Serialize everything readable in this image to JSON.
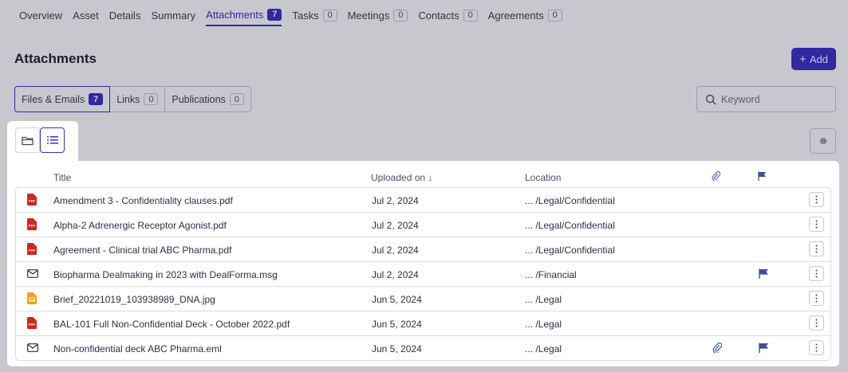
{
  "nav": {
    "tabs": [
      {
        "label": "Overview",
        "count": null
      },
      {
        "label": "Asset",
        "count": null
      },
      {
        "label": "Details",
        "count": null
      },
      {
        "label": "Summary",
        "count": null
      },
      {
        "label": "Attachments",
        "count": "7"
      },
      {
        "label": "Tasks",
        "count": "0"
      },
      {
        "label": "Meetings",
        "count": "0"
      },
      {
        "label": "Contacts",
        "count": "0"
      },
      {
        "label": "Agreements",
        "count": "0"
      }
    ]
  },
  "header": {
    "title": "Attachments",
    "add_label": "Add"
  },
  "subtabs": [
    {
      "label": "Files & Emails",
      "count": "7"
    },
    {
      "label": "Links",
      "count": "0"
    },
    {
      "label": "Publications",
      "count": "0"
    }
  ],
  "search": {
    "placeholder": "Keyword"
  },
  "table": {
    "columns": {
      "title": "Title",
      "uploaded": "Uploaded on ↓",
      "location": "Location"
    },
    "rows": [
      {
        "icon": "pdf-icon",
        "title": "Amendment 3 - Confidentiality clauses.pdf",
        "date": "Jul 2, 2024",
        "location": "... /Legal/Confidential",
        "attachment": false,
        "flag": false
      },
      {
        "icon": "pdf-icon",
        "title": "Alpha-2 Adrenergic Receptor Agonist.pdf",
        "date": "Jul 2, 2024",
        "location": "... /Legal/Confidential",
        "attachment": false,
        "flag": false
      },
      {
        "icon": "pdf-icon",
        "title": "Agreement - Clinical trial ABC Pharma.pdf",
        "date": "Jul 2, 2024",
        "location": "... /Legal/Confidential",
        "attachment": false,
        "flag": false
      },
      {
        "icon": "email-icon",
        "title": "Biopharma Dealmaking in 2023 with DealForma.msg",
        "date": "Jul 2, 2024",
        "location": "... /Financial",
        "attachment": false,
        "flag": true
      },
      {
        "icon": "image-icon",
        "title": "Brief_20221019_103938989_DNA.jpg",
        "date": "Jun 5, 2024",
        "location": "... /Legal",
        "attachment": false,
        "flag": false
      },
      {
        "icon": "pdf-icon",
        "title": "BAL-101 Full Non-Confidential Deck - October 2022.pdf",
        "date": "Jun 5, 2024",
        "location": "... /Legal",
        "attachment": false,
        "flag": false
      },
      {
        "icon": "email-icon",
        "title": "Non-confidential deck ABC Pharma.eml",
        "date": "Jun 5, 2024",
        "location": "... /Legal",
        "attachment": true,
        "flag": true
      }
    ]
  },
  "colors": {
    "accent": "#3b2fc9",
    "flag": "#3d4f9e",
    "pdf": "#d0271d",
    "image": "#f0a020"
  }
}
